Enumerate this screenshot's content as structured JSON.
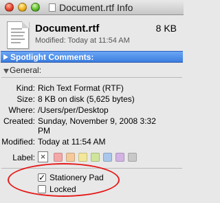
{
  "window": {
    "title": "Document.rtf Info"
  },
  "summary": {
    "file_name": "Document.rtf",
    "file_size": "8 KB",
    "modified": "Modified: Today at 11:54 AM"
  },
  "spotlight": {
    "label": "Spotlight Comments:"
  },
  "general": {
    "label": "General:",
    "rows": [
      {
        "label": "Kind:",
        "value": "Rich Text Format (RTF)"
      },
      {
        "label": "Size:",
        "value": "8 KB on disk (5,625 bytes)"
      },
      {
        "label": "Where:",
        "value": "/Users/per/Desktop"
      },
      {
        "label": "Created:",
        "value": "Sunday, November 9, 2008 3:32",
        "value2": "PM"
      },
      {
        "label": "Modified:",
        "value": "Today at 11:54 AM"
      }
    ],
    "color_label": {
      "label": "Label:",
      "none_symbol": "×",
      "swatches": [
        "#f4a8a8",
        "#f5c99a",
        "#f3e79a",
        "#cfe59c",
        "#a9c7ea",
        "#d2b3e4",
        "#c8c8c8"
      ]
    },
    "checkboxes": [
      {
        "label": "Stationery Pad",
        "checked": true
      },
      {
        "label": "Locked",
        "checked": false
      }
    ]
  },
  "accent_colors": {
    "spotlight_bar": "#3d7fe0",
    "highlight_ring": "#e51a1a"
  }
}
